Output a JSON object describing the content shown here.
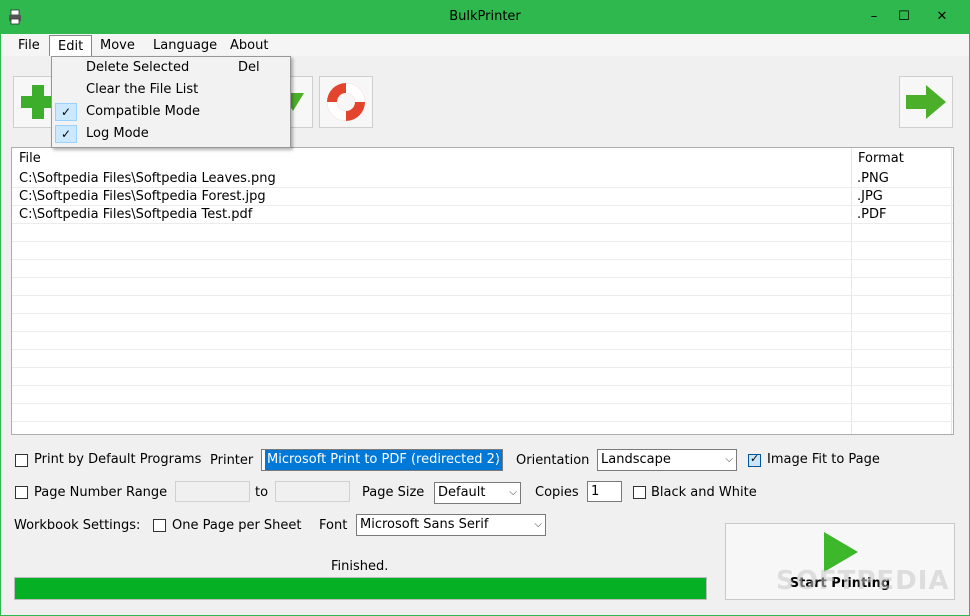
{
  "window": {
    "title": "BulkPrinter",
    "minimize": "–",
    "maximize": "☐",
    "close": "✕"
  },
  "menubar": [
    "File",
    "Edit",
    "Move",
    "Language",
    "About"
  ],
  "edit_menu": {
    "items": [
      {
        "label": "Delete Selected",
        "shortcut": "Del",
        "checked": false
      },
      {
        "label": "Clear the File List",
        "shortcut": "",
        "checked": false
      },
      {
        "label": "Compatible Mode",
        "shortcut": "",
        "checked": true
      },
      {
        "label": "Log Mode",
        "shortcut": "",
        "checked": true
      }
    ]
  },
  "toolbar": {
    "icons": [
      "add-icon",
      "move-down-icon",
      "help-icon",
      "next-icon"
    ]
  },
  "filelist": {
    "columns": [
      "File",
      "Format"
    ],
    "rows": [
      {
        "file": "C:\\Softpedia Files\\Softpedia Leaves.png",
        "format": ".PNG"
      },
      {
        "file": "C:\\Softpedia Files\\Softpedia Forest.jpg",
        "format": ".JPG"
      },
      {
        "file": "C:\\Softpedia Files\\Softpedia Test.pdf",
        "format": ".PDF"
      }
    ]
  },
  "options": {
    "print_default_label": "Print by Default Programs",
    "print_default_checked": false,
    "printer_label": "Printer",
    "printer_value": "Microsoft Print to PDF (redirected 2)",
    "orientation_label": "Orientation",
    "orientation_value": "Landscape",
    "image_fit_label": "Image Fit to Page",
    "image_fit_checked": true,
    "page_range_label": "Page Number Range",
    "page_range_checked": false,
    "to_label": "to",
    "page_size_label": "Page Size",
    "page_size_value": "Default",
    "copies_label": "Copies",
    "copies_value": "1",
    "bw_label": "Black and White",
    "bw_checked": false,
    "workbook_label": "Workbook Settings:",
    "one_page_label": "One Page per Sheet",
    "one_page_checked": false,
    "font_label": "Font",
    "font_value": "Microsoft Sans Serif"
  },
  "status": {
    "text": "Finished.",
    "progress": 1.0
  },
  "start_button": {
    "label": "Start Printing"
  },
  "watermark": "SOFTPEDIA",
  "colors": {
    "titlebar": "#2fb84d",
    "progress": "#06b025",
    "selection": "#0078d7"
  }
}
